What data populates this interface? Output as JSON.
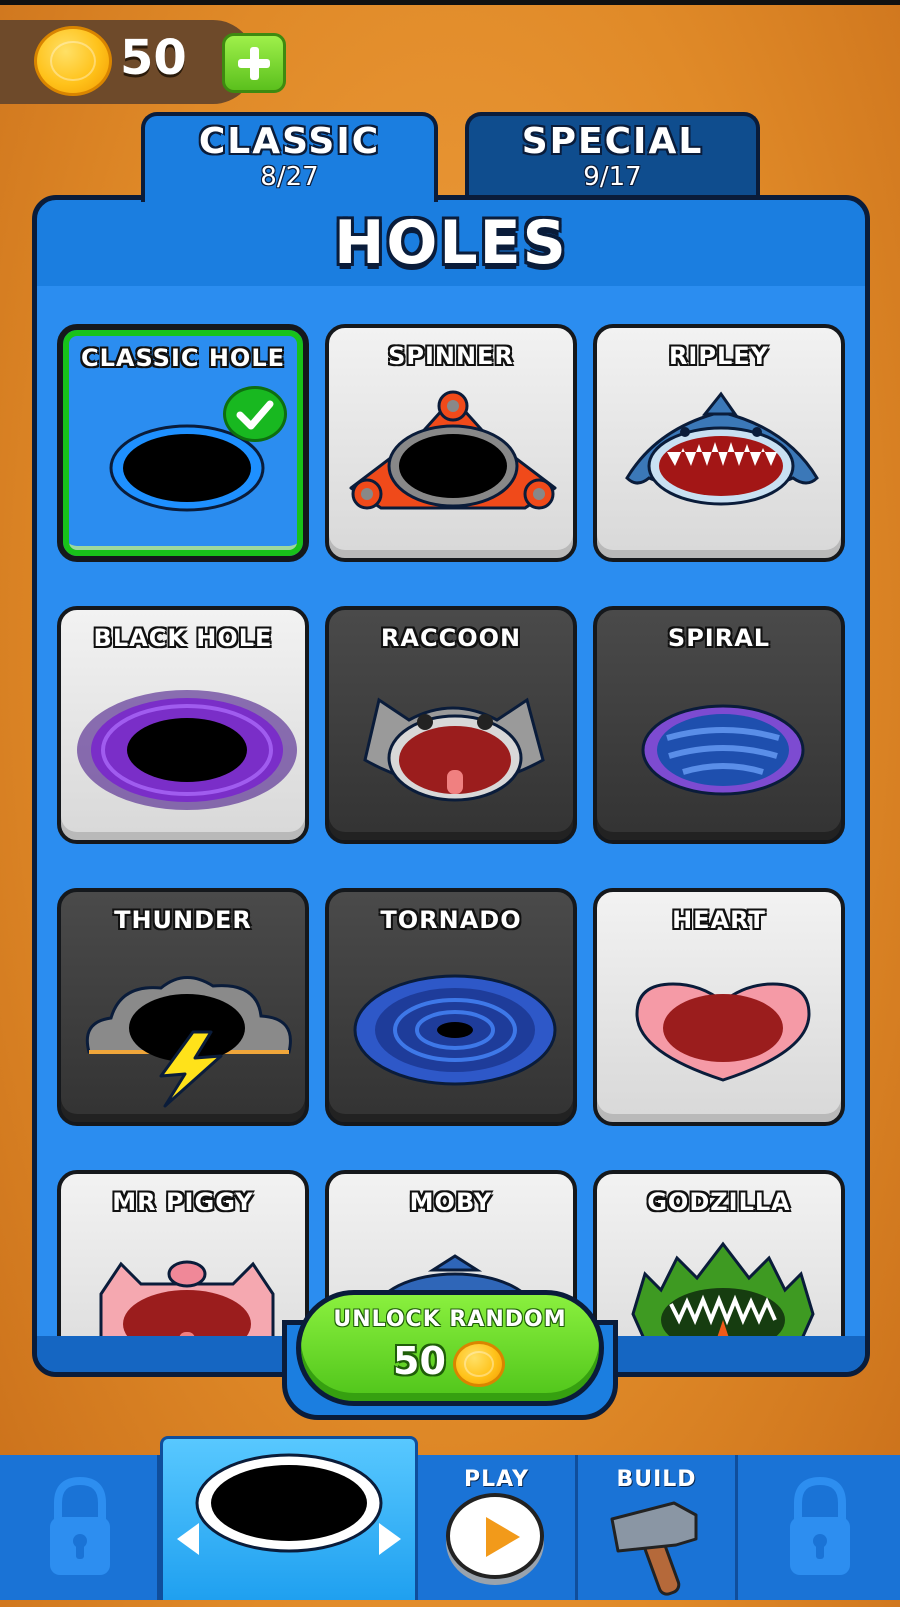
{
  "header": {
    "coins": "50"
  },
  "tabs": [
    {
      "title": "CLASSIC",
      "count": "8/27",
      "active": true
    },
    {
      "title": "SPECIAL",
      "count": "9/17",
      "active": false
    }
  ],
  "panel": {
    "title": "HOLES"
  },
  "cards": [
    {
      "label": "CLASSIC HOLE",
      "state": "selected",
      "icon": "classic-hole-icon"
    },
    {
      "label": "SPINNER",
      "state": "unlocked",
      "icon": "spinner-hole-icon"
    },
    {
      "label": "RIPLEY",
      "state": "unlocked",
      "icon": "shark-hole-icon"
    },
    {
      "label": "BLACK HOLE",
      "state": "unlocked",
      "icon": "black-hole-icon"
    },
    {
      "label": "RACCOON",
      "state": "locked",
      "icon": "raccoon-hole-icon"
    },
    {
      "label": "SPIRAL",
      "state": "locked",
      "icon": "spiral-hole-icon"
    },
    {
      "label": "THUNDER",
      "state": "locked",
      "icon": "thunder-hole-icon"
    },
    {
      "label": "TORNADO",
      "state": "locked",
      "icon": "tornado-hole-icon"
    },
    {
      "label": "HEART",
      "state": "unlocked",
      "icon": "heart-hole-icon"
    },
    {
      "label": "MR PIGGY",
      "state": "unlocked",
      "icon": "pig-hole-icon"
    },
    {
      "label": "MOBY",
      "state": "unlocked",
      "icon": "whale-hole-icon"
    },
    {
      "label": "GODZILLA",
      "state": "unlocked",
      "icon": "godzilla-hole-icon"
    }
  ],
  "unlock": {
    "label": "UNLOCK RANDOM",
    "cost": "50"
  },
  "nav": {
    "play_label": "PLAY",
    "build_label": "BUILD"
  },
  "colors": {
    "background": "#e08a28",
    "panel": "#1b7ee0",
    "selected_border": "#18c21a",
    "coin": "#ffc21a",
    "button_green": "#5bc01d"
  }
}
